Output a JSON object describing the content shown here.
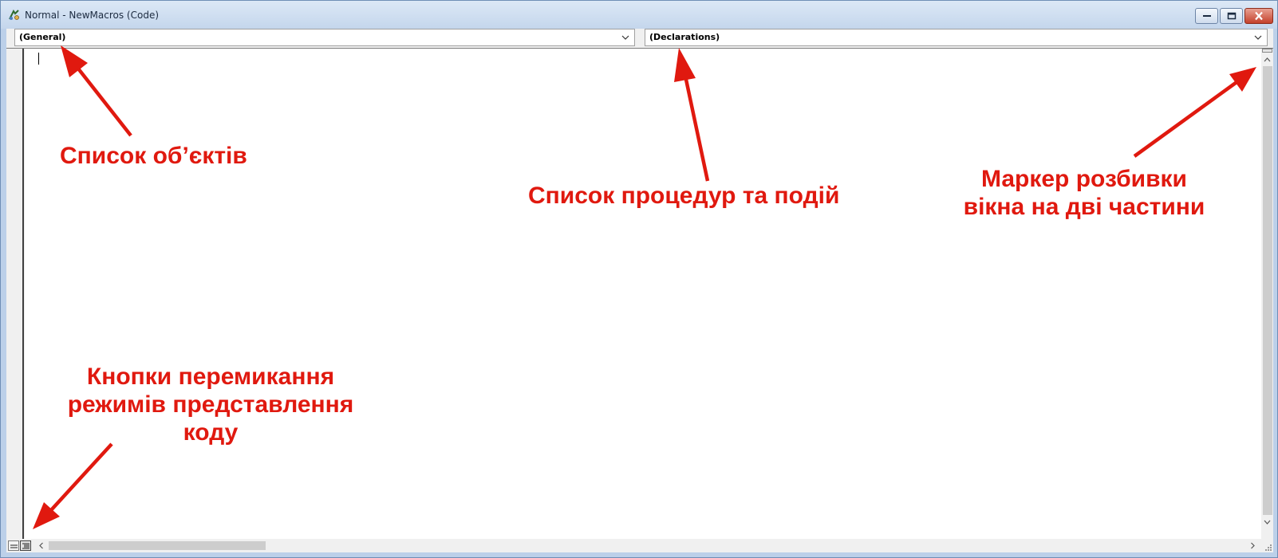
{
  "window": {
    "title": "Normal - NewMacros (Code)",
    "icon": "vba-module-icon",
    "controls": [
      "minimize-icon",
      "maximize-icon",
      "close-icon"
    ]
  },
  "object_list": {
    "selected": "(General)"
  },
  "procedure_list": {
    "selected": "(Declarations)"
  },
  "editor": {
    "content": ""
  },
  "annotations": {
    "object_list": "Список об’єктів",
    "procedure_list": "Список процедур та подій",
    "split_marker": "Маркер розбивки вікна на дві частини",
    "view_buttons": "Кнопки перемикання режимів представлення коду"
  },
  "colors": {
    "annotation": "#e0190f",
    "titlebar": "#c4d6ec",
    "editor_background": "#ffffff"
  }
}
